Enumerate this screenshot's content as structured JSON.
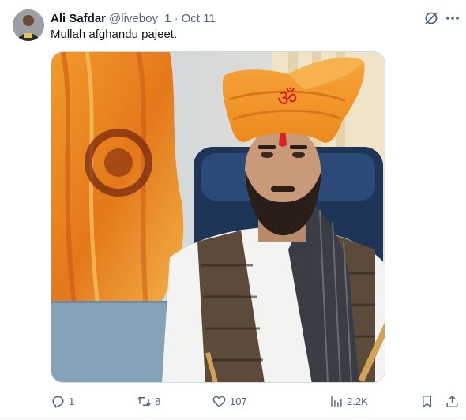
{
  "tweet": {
    "author_name": "Ali Safdar",
    "handle": "@liveboy_1",
    "separator": "·",
    "date": "Oct 11",
    "text": "Mullah afghandu pajeet."
  },
  "media": {
    "description_icon": "photo",
    "turban_symbol": "ॐ"
  },
  "actions": {
    "reply_count": "1",
    "retweet_count": "8",
    "like_count": "107",
    "view_count": "2.2K"
  },
  "colors": {
    "text_primary": "#0f1419",
    "text_secondary": "#536471",
    "turban_orange": "#f08a1c"
  }
}
